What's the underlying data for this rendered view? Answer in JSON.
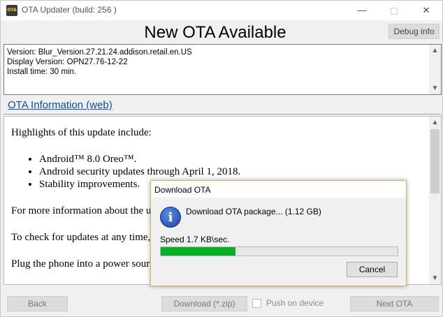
{
  "window": {
    "title": "OTA Updater (build: 256 )",
    "app_icon_text": "OTA",
    "minimize_glyph": "—",
    "close_glyph": "✕"
  },
  "header": {
    "heading": "New OTA Available",
    "debug_label": "Debug info"
  },
  "version_info": {
    "lines": [
      "Version: Blur_Version.27.21.24.addison.retail.en.US",
      "Display Version: OPN27.76-12-22",
      "Install time: 30 min."
    ],
    "scroll_up_glyph": "▲",
    "scroll_down_glyph": "▼"
  },
  "ota_link": "OTA Information (web)",
  "content": {
    "intro": "Highlights of this update include:",
    "bullets": [
      "Android™ 8.0 Oreo™.",
      "Android security updates through April 1, 2018.",
      "Stability improvements."
    ],
    "p1": "For more information about the up",
    "p2": "To check for updates at any time,",
    "p3": "Plug the phone into a power sourc",
    "scroll_up_glyph": "▲",
    "scroll_down_glyph": "▼"
  },
  "bottom": {
    "back_label": "Back",
    "download_label": "Download (*.zip)",
    "push_label": "Push on device",
    "next_label": "Next OTA"
  },
  "dialog": {
    "title": "Download OTA",
    "icon_glyph": "i",
    "message": "Download OTA package... (1.12 GB)",
    "speed": "Speed 1.7 KB\\sec.",
    "progress_fraction": 0.315,
    "cancel_label": "Cancel"
  },
  "colors": {
    "link": "#0a4fa5",
    "progress": "#06b025",
    "dialog_border": "#d2b55a"
  }
}
